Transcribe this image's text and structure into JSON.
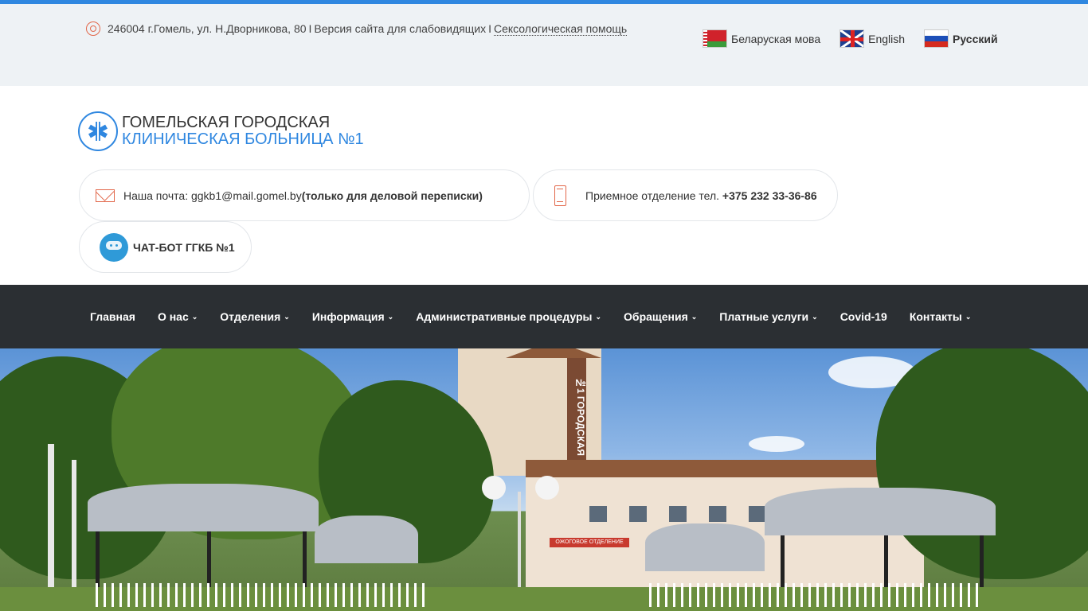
{
  "topbar": {
    "address": "246004 г.Гомель, ул. Н.Дворникова, 80",
    "separator": "I",
    "low_vision_link": "Версия сайта для слабовидящих",
    "sexology_link": "Сексологическая помощь"
  },
  "languages": [
    {
      "label": "Беларуская мова",
      "flag": "flag-by-icon",
      "active": false
    },
    {
      "label": "English",
      "flag": "flag-uk-icon",
      "active": false
    },
    {
      "label": "Русский",
      "flag": "flag-ru-icon",
      "active": true
    }
  ],
  "logo": {
    "line1": "Гомельская городская",
    "line2": "клиническая больница №1"
  },
  "contacts": {
    "mail_prefix": "Наша почта: ggkb1@mail.gomel.by",
    "mail_note": "(только для деловой переписки)",
    "phone_prefix": "Приемное отделение тел.",
    "phone_number": "+375 232 33-36-86",
    "chatbot_label": "ЧАТ-БОТ ГГКБ №1"
  },
  "nav": {
    "items": [
      {
        "label": "Главная",
        "has_dropdown": false
      },
      {
        "label": "О нас",
        "has_dropdown": true
      },
      {
        "label": "Отделения",
        "has_dropdown": true
      },
      {
        "label": "Информация",
        "has_dropdown": true
      },
      {
        "label": "Административные процедуры",
        "has_dropdown": true
      },
      {
        "label": "Обращения",
        "has_dropdown": true
      },
      {
        "label": "Платные услуги",
        "has_dropdown": true
      },
      {
        "label": "Covid-19",
        "has_dropdown": false
      },
      {
        "label": "Контакты",
        "has_dropdown": true
      }
    ],
    "chevron": "⌄"
  },
  "hero": {
    "tower_sign": "№1 ГОРОДСКАЯ",
    "building_label": "ОЖОГОВОЕ ОТДЕЛЕНИЕ"
  },
  "colors": {
    "accent": "#2f87e0",
    "icon_orange": "#e2674a",
    "nav_bg": "#2b2f33",
    "topbar_bg": "#eef2f5"
  }
}
